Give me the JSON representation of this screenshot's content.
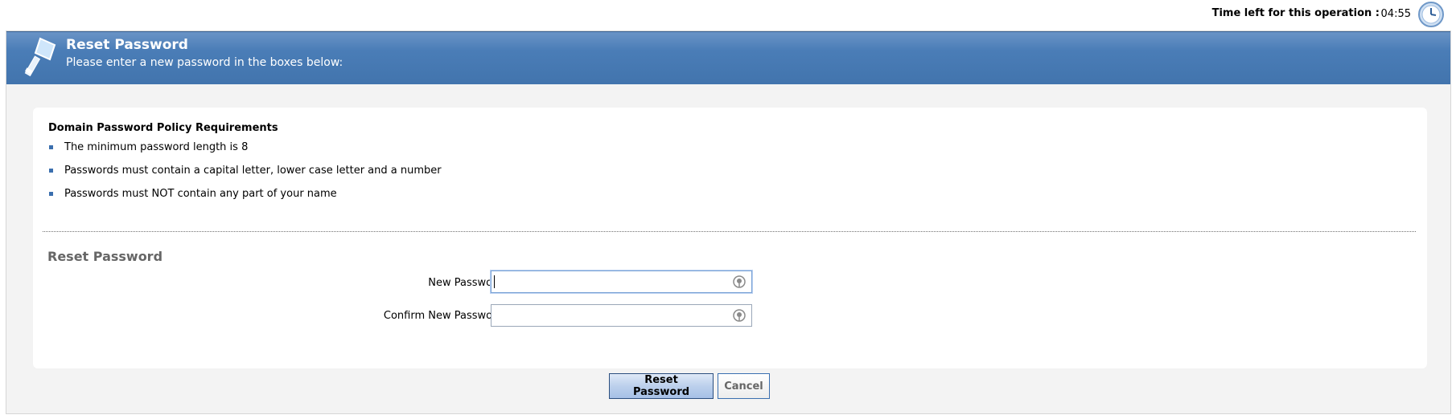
{
  "timer": {
    "label": "Time left for this operation :",
    "value": "04:55",
    "icon": "clock-icon"
  },
  "header": {
    "title": "Reset Password",
    "subtitle": "Please enter a new password in the boxes below:",
    "icon": "key-icon",
    "color": "#4274ad"
  },
  "policy": {
    "title": "Domain Password Policy Requirements",
    "items": [
      "The minimum password length is 8",
      "Passwords must contain a capital letter, lower case letter and a number",
      "Passwords must NOT contain any part of your name"
    ]
  },
  "form": {
    "section_title": "Reset Password",
    "new_password_label": "New Password :",
    "new_password_value": "",
    "confirm_password_label": "Confirm New Password :",
    "confirm_password_value": ""
  },
  "buttons": {
    "reset_label": "Reset Password",
    "cancel_label": "Cancel"
  }
}
